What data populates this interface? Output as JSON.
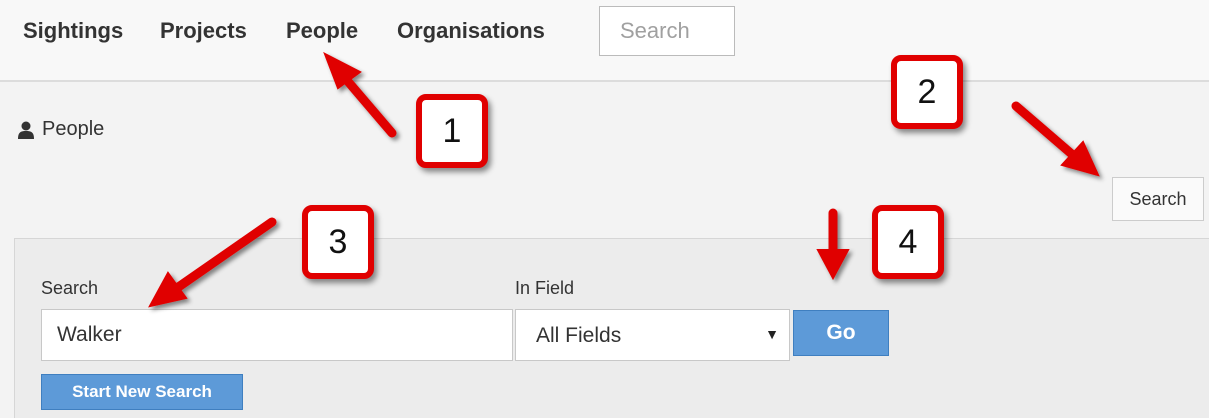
{
  "nav": {
    "items": [
      {
        "label": "Sightings"
      },
      {
        "label": "Projects"
      },
      {
        "label": "People"
      },
      {
        "label": "Organisations"
      }
    ],
    "search_placeholder": "Search"
  },
  "page": {
    "title": "People",
    "title_icon": "person-icon",
    "search_toggle_label": "Search"
  },
  "search_panel": {
    "search_label": "Search",
    "search_value": "Walker",
    "field_label": "In Field",
    "field_selected": "All Fields",
    "go_label": "Go",
    "new_search_label": "Start New Search"
  },
  "callouts": [
    "1",
    "2",
    "3",
    "4"
  ],
  "colors": {
    "callout_red": "#e00000",
    "button_blue": "#5d9ad8"
  }
}
